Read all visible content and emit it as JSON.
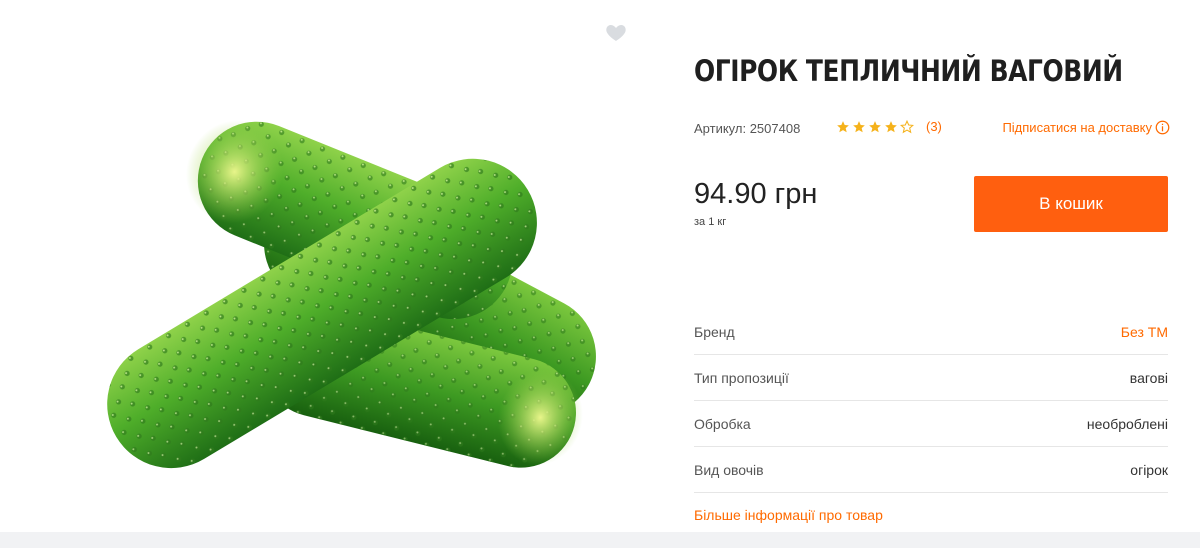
{
  "product": {
    "title": "ОГІРОК ТЕПЛИЧНИЙ ВАГОВИЙ",
    "sku": "Артикул: 2507408",
    "rating_value": 4,
    "rating_max": 5,
    "rating_count": "(3)",
    "subscribe_label": "Підписатися на доставку",
    "price": "94.90 грн",
    "unit": "за 1 кг",
    "cart_button": "В кошик",
    "more_link": "Більше інформації про товар"
  },
  "properties": [
    {
      "label": "Бренд",
      "value": "Без ТМ",
      "link": true
    },
    {
      "label": "Тип пропозиції",
      "value": "вагові",
      "link": false
    },
    {
      "label": "Обробка",
      "value": "необроблені",
      "link": false
    },
    {
      "label": "Вид овочів",
      "value": "огірок",
      "link": false
    }
  ],
  "icons": {
    "favorite": "heart-icon",
    "star_filled": "star-icon",
    "star_empty": "star-outline-icon",
    "info": "info-icon"
  },
  "colors": {
    "accent": "#ff5f0f",
    "link": "#ff6a00",
    "star": "#f5b21b",
    "heart": "#d9dce0"
  }
}
